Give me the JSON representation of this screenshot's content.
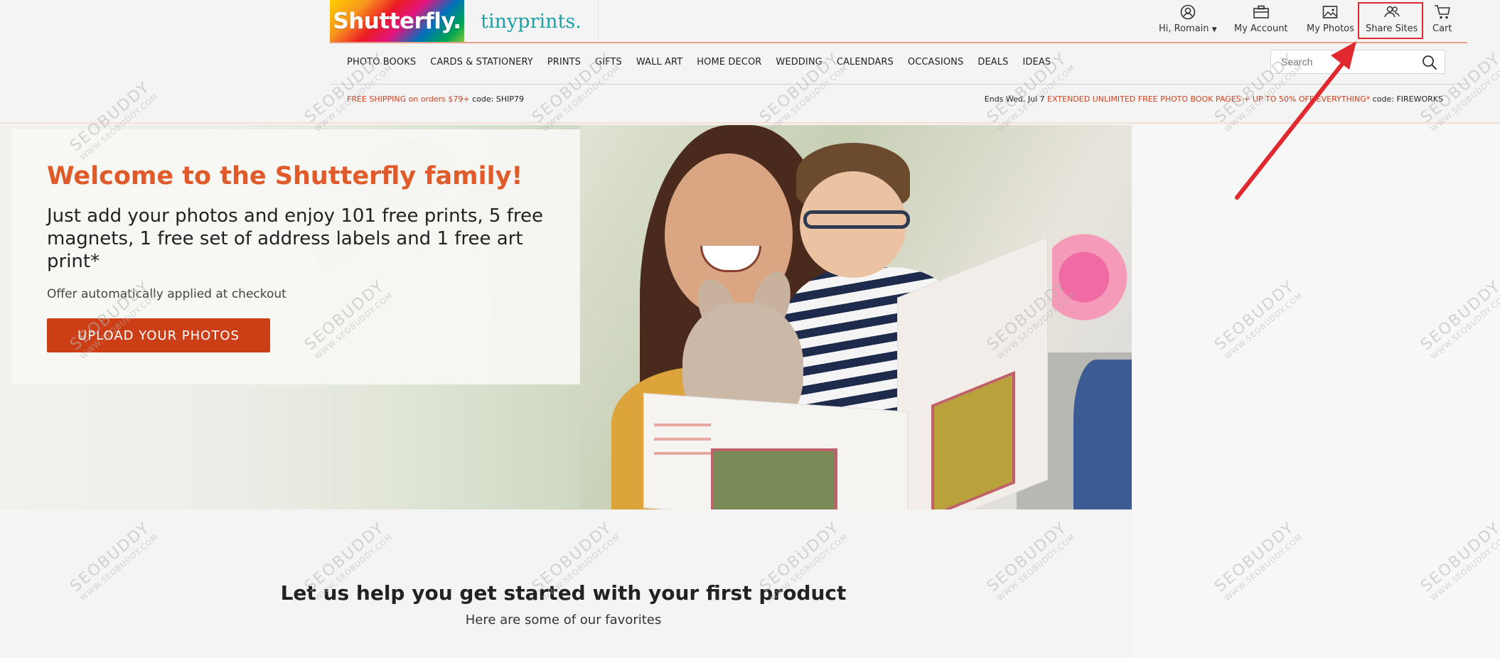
{
  "brand": {
    "shutterfly_logo": "Shutterfly.",
    "tinyprints_logo": "tinyprints."
  },
  "header": {
    "account_greeting": "Hi, Romain",
    "my_account": "My Account",
    "my_photos": "My Photos",
    "share_sites": "Share Sites",
    "cart": "Cart"
  },
  "nav": {
    "items": [
      "PHOTO BOOKS",
      "CARDS & STATIONERY",
      "PRINTS",
      "GIFTS",
      "WALL ART",
      "HOME DECOR",
      "WEDDING",
      "CALENDARS",
      "OCCASIONS",
      "DEALS",
      "IDEAS"
    ]
  },
  "search": {
    "placeholder": "Search"
  },
  "promo": {
    "left_highlight": "FREE SHIPPING on orders $79+",
    "left_code": " code: SHIP79",
    "right_prefix": "Ends Wed, Jul 7 ",
    "right_highlight": "EXTENDED UNLIMITED FREE PHOTO BOOK PAGES + UP TO 50% OFF EVERYTHING*",
    "right_code": " code: FIREWORKS"
  },
  "hero": {
    "title": "Welcome to the Shutterfly family!",
    "body": "Just add your photos and enjoy 101 free prints, 5 free magnets, 1 free set of address labels and 1 free art print*",
    "note": "Offer automatically applied at checkout",
    "cta": "UPLOAD YOUR PHOTOS"
  },
  "section": {
    "title": "Let us help you get started with your first product",
    "subtitle": "Here are some of our favorites"
  },
  "watermark": {
    "text": "SEOBUDDY",
    "url": "WWW.SEOBUDDY.COM"
  },
  "colors": {
    "accent": "#cc3e16",
    "headline": "#e05a2a",
    "annotation": "#e0282e",
    "tinyprints": "#1aa1a8"
  }
}
